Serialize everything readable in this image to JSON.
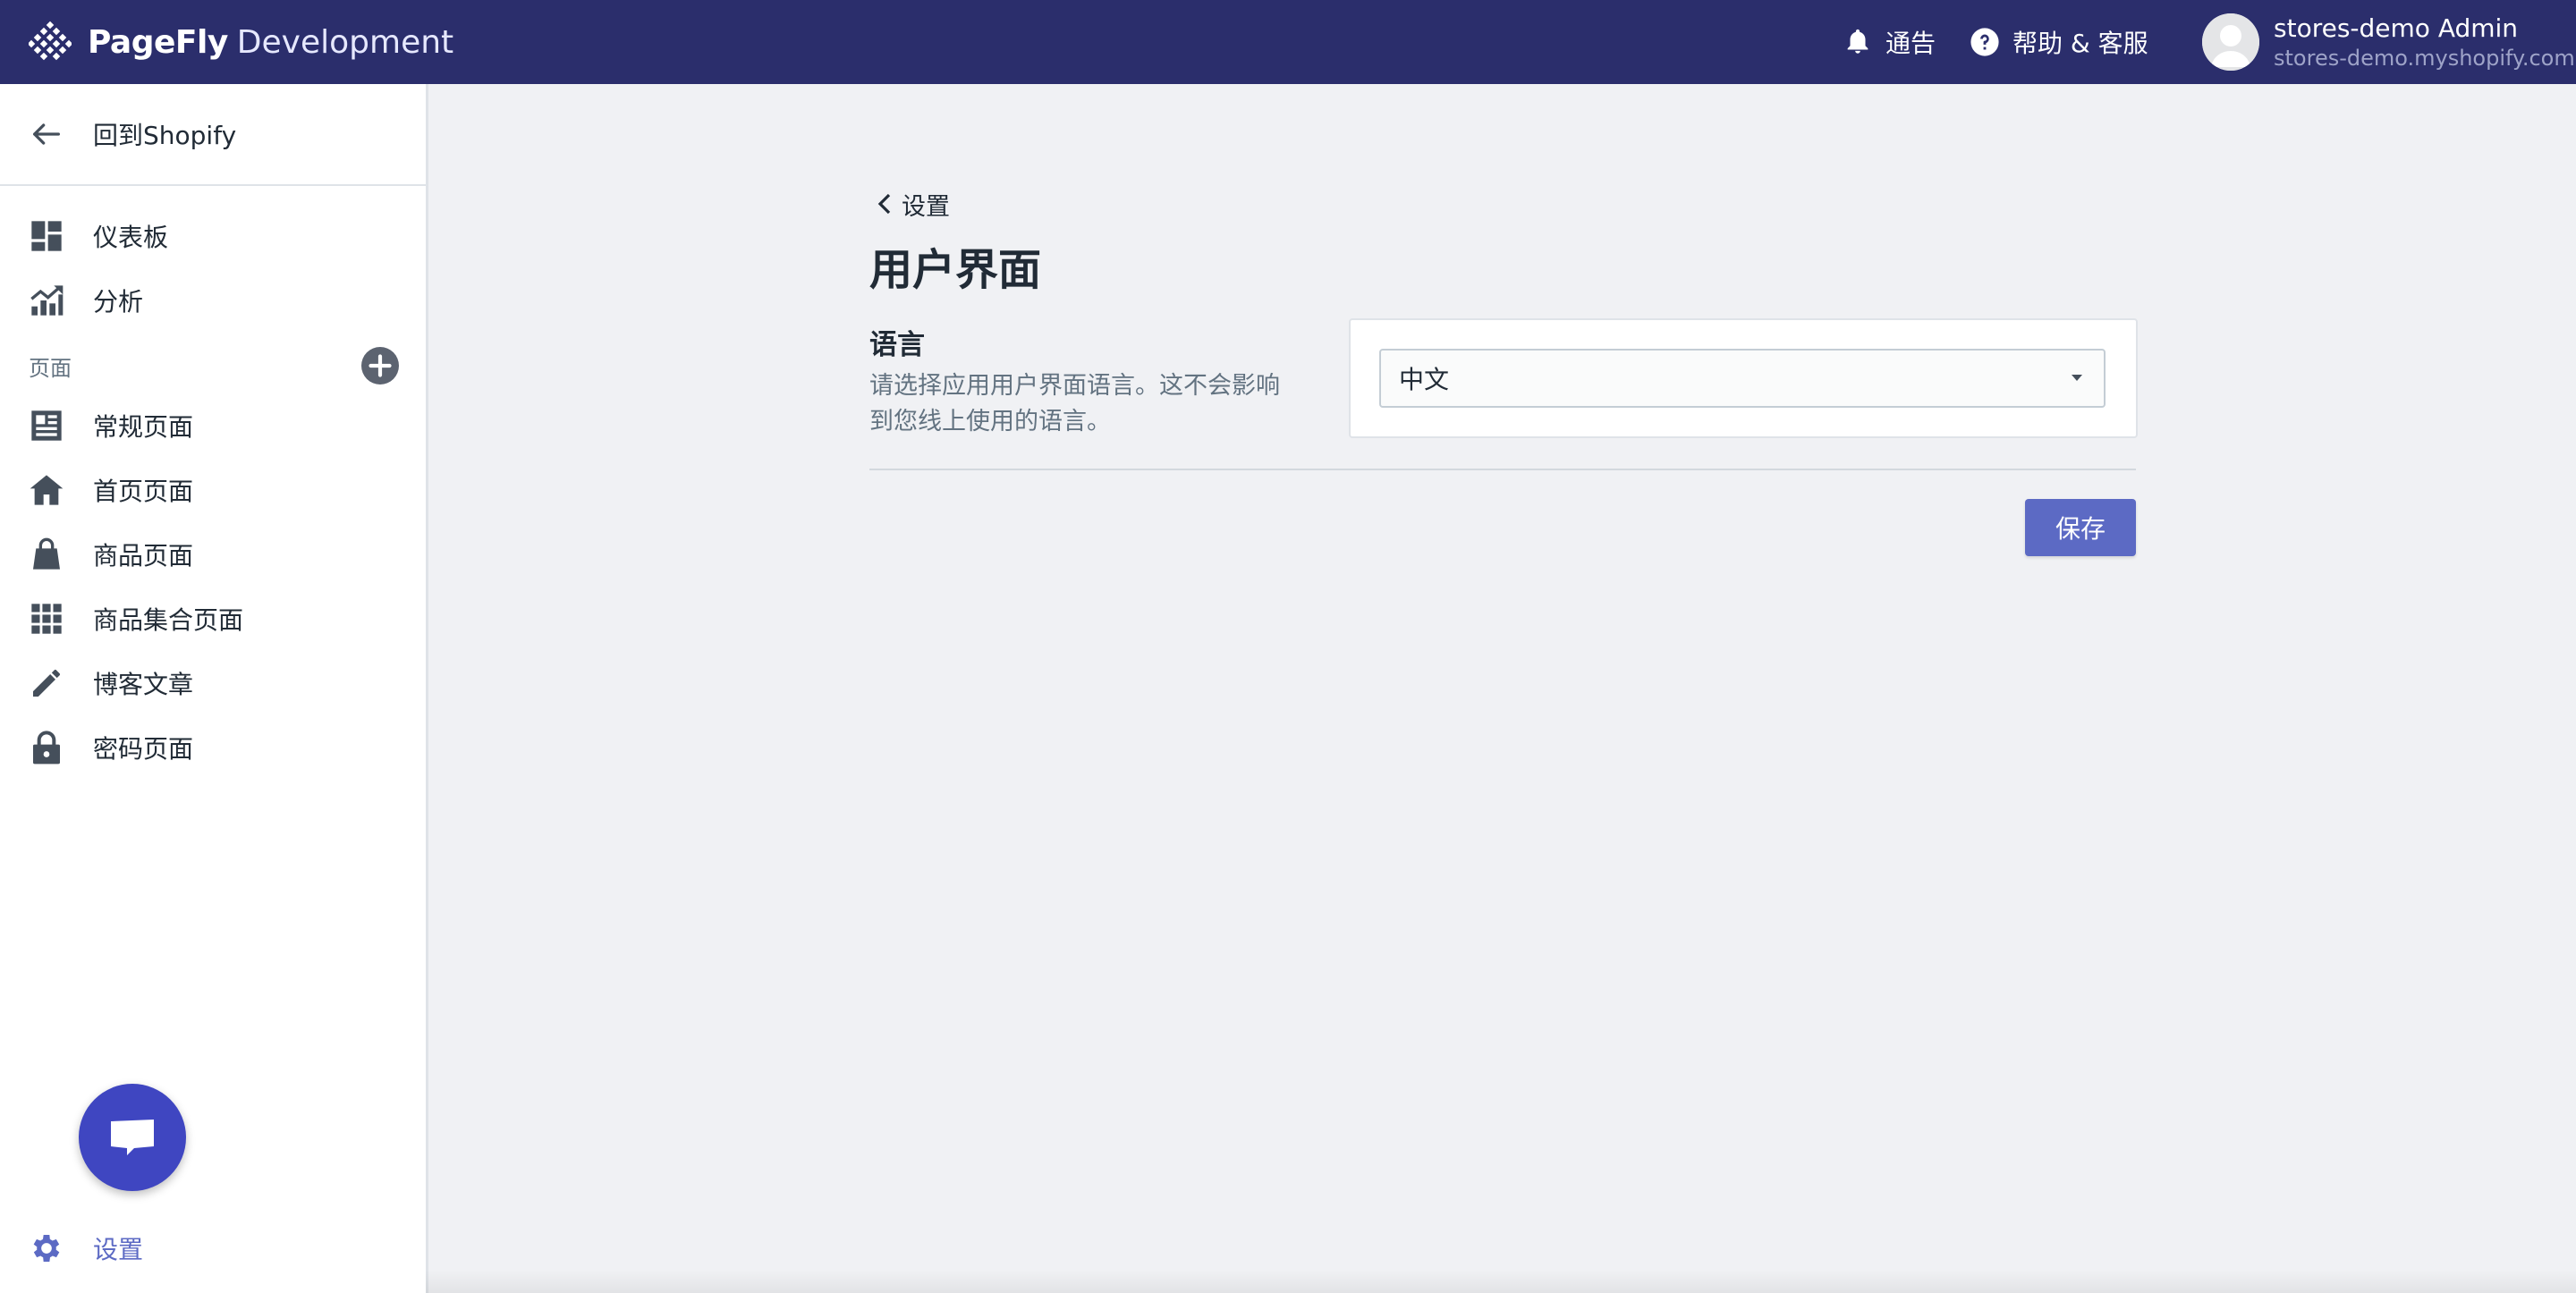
{
  "header": {
    "brand": "PageFly",
    "brand_suffix": "Development",
    "notice_label": "通告",
    "help_label": "帮助 & 客服",
    "user_name": "stores-demo Admin",
    "user_domain": "stores-demo.myshopify.com"
  },
  "sidebar": {
    "back_label": "回到Shopify",
    "items": [
      {
        "label": "仪表板",
        "icon": "dashboard-icon"
      },
      {
        "label": "分析",
        "icon": "analytics-icon"
      }
    ],
    "pages_section_label": "页面",
    "page_items": [
      {
        "label": "常规页面",
        "icon": "page-icon"
      },
      {
        "label": "首页页面",
        "icon": "home-icon"
      },
      {
        "label": "商品页面",
        "icon": "bag-icon"
      },
      {
        "label": "商品集合页面",
        "icon": "grid-icon"
      },
      {
        "label": "博客文章",
        "icon": "pencil-icon"
      },
      {
        "label": "密码页面",
        "icon": "lock-icon"
      }
    ],
    "settings_label": "设置"
  },
  "main": {
    "breadcrumb": "设置",
    "title": "用户界面",
    "language_section_title": "语言",
    "language_section_desc": "请选择应用用户界面语言。这不会影响到您线上使用的语言。",
    "language_selected": "中文",
    "save_label": "保存"
  },
  "colors": {
    "topbar": "#2b2e6c",
    "accent": "#5c6ac4",
    "chat_button": "#3f46c1",
    "background": "#f0f1f4"
  }
}
